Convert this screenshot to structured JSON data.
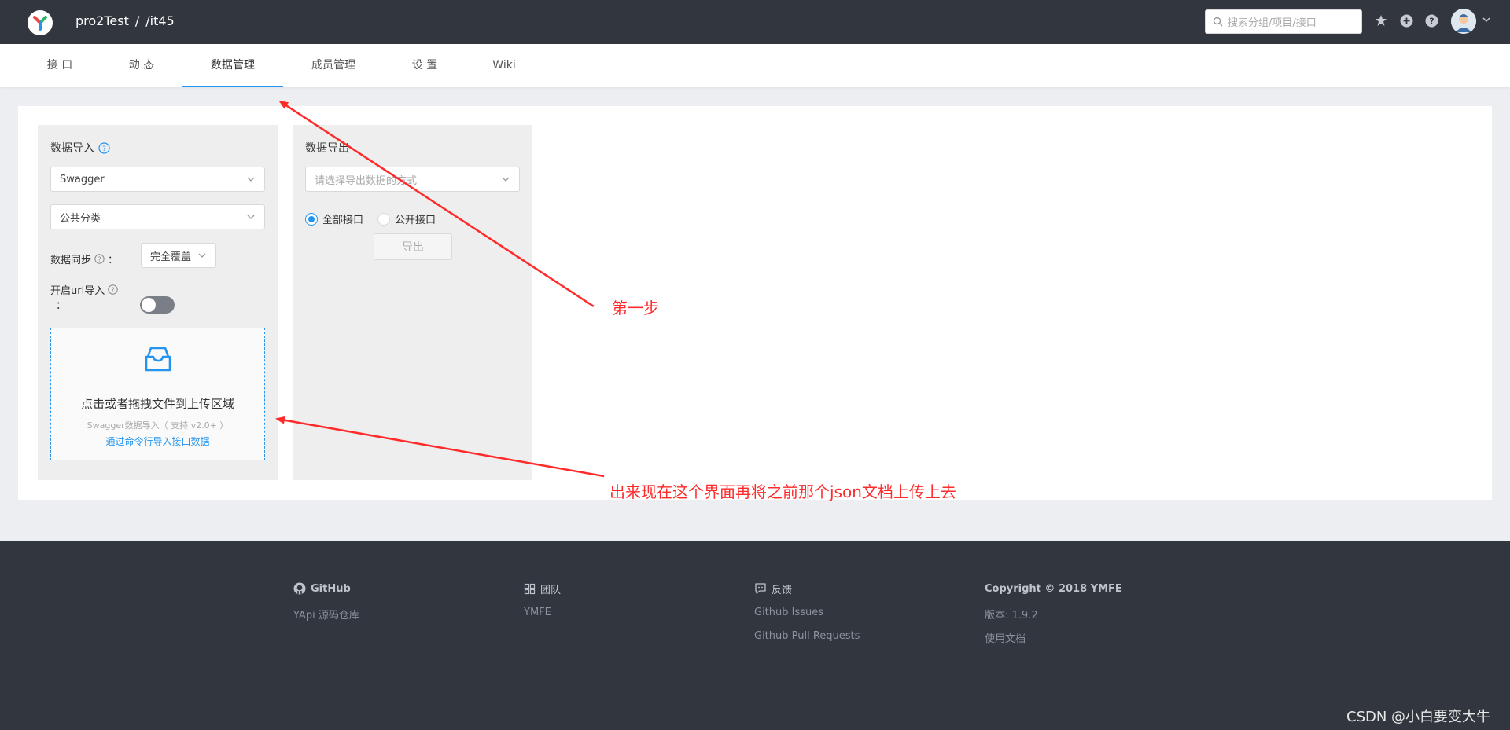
{
  "header": {
    "project_group": "pro2Test",
    "separator": "/",
    "project_name": "/it45",
    "search_placeholder": "搜索分组/项目/接口"
  },
  "tabs": [
    {
      "label": "接 口"
    },
    {
      "label": "动 态"
    },
    {
      "label": "数据管理"
    },
    {
      "label": "成员管理"
    },
    {
      "label": "设 置"
    },
    {
      "label": "Wiki"
    }
  ],
  "import_panel": {
    "title": "数据导入",
    "format_select": "Swagger",
    "category_select": "公共分类",
    "sync_label": "数据同步",
    "sync_colon": "：",
    "sync_mode": "完全覆盖",
    "url_import_label": "开启url导入",
    "url_import_colon": "：",
    "url_import_enabled": false,
    "upload_main": "点击或者拖拽文件到上传区域",
    "upload_hint": "Swagger数据导入（ 支持 v2.0+ ）",
    "upload_cli_link": "通过命令行导入接口数据"
  },
  "export_panel": {
    "title": "数据导出",
    "format_placeholder": "请选择导出数据的方式",
    "radio_all": "全部接口",
    "radio_public": "公开接口",
    "selected_radio": "全部接口",
    "export_button": "导出"
  },
  "footer": {
    "columns": [
      {
        "heading": "GitHub",
        "links": [
          "YApi 源码仓库"
        ]
      },
      {
        "heading": "团队",
        "links": [
          "YMFE"
        ]
      },
      {
        "heading": "反馈",
        "links": [
          "Github Issues",
          "Github Pull Requests"
        ]
      },
      {
        "heading": "Copyright © 2018 YMFE",
        "links": [
          "版本: 1.9.2",
          "使用文档"
        ]
      }
    ]
  },
  "annotations": {
    "step1": "第一步",
    "note": "出来现在这个界面再将之前那个json文档上传上去",
    "color": "#ff2a2a"
  },
  "watermark": "CSDN @小白要变大牛",
  "colors": {
    "header_bg": "#32363f",
    "accent": "#2395f1",
    "page_bg": "#eceef1"
  }
}
